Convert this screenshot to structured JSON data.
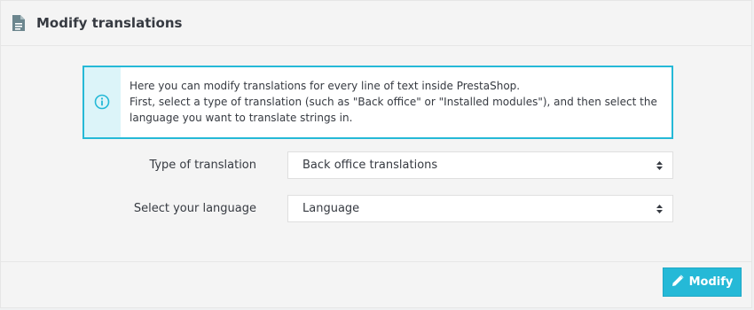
{
  "panel": {
    "title": "Modify translations",
    "title_icon": "document-icon"
  },
  "alert": {
    "icon": "info-icon",
    "lines": [
      "Here you can modify translations for every line of text inside PrestaShop.",
      "First, select a type of translation (such as \"Back office\" or \"Installed modules\"), and then select the",
      "language you want to translate strings in."
    ]
  },
  "form": {
    "type": {
      "label": "Type of translation",
      "selected": "Back office translations"
    },
    "language": {
      "label": "Select your language",
      "selected": "Language"
    }
  },
  "footer": {
    "modify_label": "Modify",
    "modify_icon": "pencil-icon"
  },
  "colors": {
    "accent": "#25b9d7",
    "alert_icon_bg": "#dcf4f9",
    "text": "#363a41",
    "panel_bg": "#f4f4f4"
  }
}
